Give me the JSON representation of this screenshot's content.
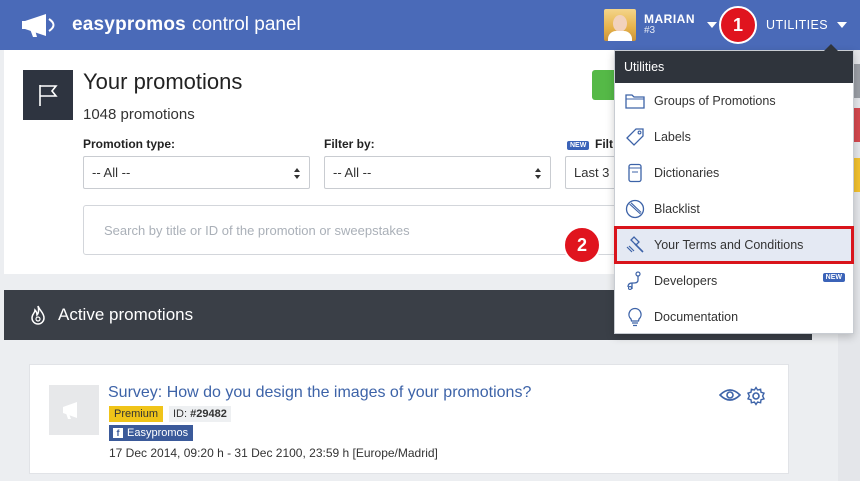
{
  "header": {
    "brand_bold": "easypromos",
    "brand_rest": "control panel",
    "user_name": "MARIAN",
    "user_id": "#3",
    "utilities_label": "UTILITIES",
    "step1": "1",
    "step2": "2"
  },
  "promotions": {
    "title": "Your promotions",
    "count": "1048 promotions",
    "filters": [
      {
        "label": "Promotion type:",
        "value": "-- All --"
      },
      {
        "label": "Filter by:",
        "value": "-- All --"
      },
      {
        "label": "Filt",
        "value": "Last 3",
        "badge": "NEW"
      }
    ],
    "search_placeholder": "Search by title or ID of the promotion or sweepstakes"
  },
  "active": {
    "heading": "Active promotions",
    "items": [
      {
        "title": "Survey: How do you design the images of your promotions?",
        "plan": "Premium",
        "id_label": "ID:",
        "id_value": "#29482",
        "network": "Easypromos",
        "dates": "17 Dec 2014, 09:20 h - 31 Dec 2100, 23:59 h [Europe/Madrid]"
      }
    ]
  },
  "utilities_menu": {
    "heading": "Utilities",
    "items": [
      {
        "label": "Groups of Promotions",
        "icon": "folder-icon"
      },
      {
        "label": "Labels",
        "icon": "tag-icon"
      },
      {
        "label": "Dictionaries",
        "icon": "book-icon"
      },
      {
        "label": "Blacklist",
        "icon": "ban-icon"
      },
      {
        "label": "Your Terms and Conditions",
        "icon": "gavel-icon",
        "highlighted": true
      },
      {
        "label": "Developers",
        "icon": "developer-icon",
        "badge": "NEW"
      },
      {
        "label": "Documentation",
        "icon": "lightbulb-icon"
      }
    ]
  },
  "colors": {
    "topbar": "#4a6ab8",
    "accent_red": "#e0141e",
    "highlight_border": "#d9141b",
    "premium": "#f0c419",
    "dark": "#2f343c"
  }
}
